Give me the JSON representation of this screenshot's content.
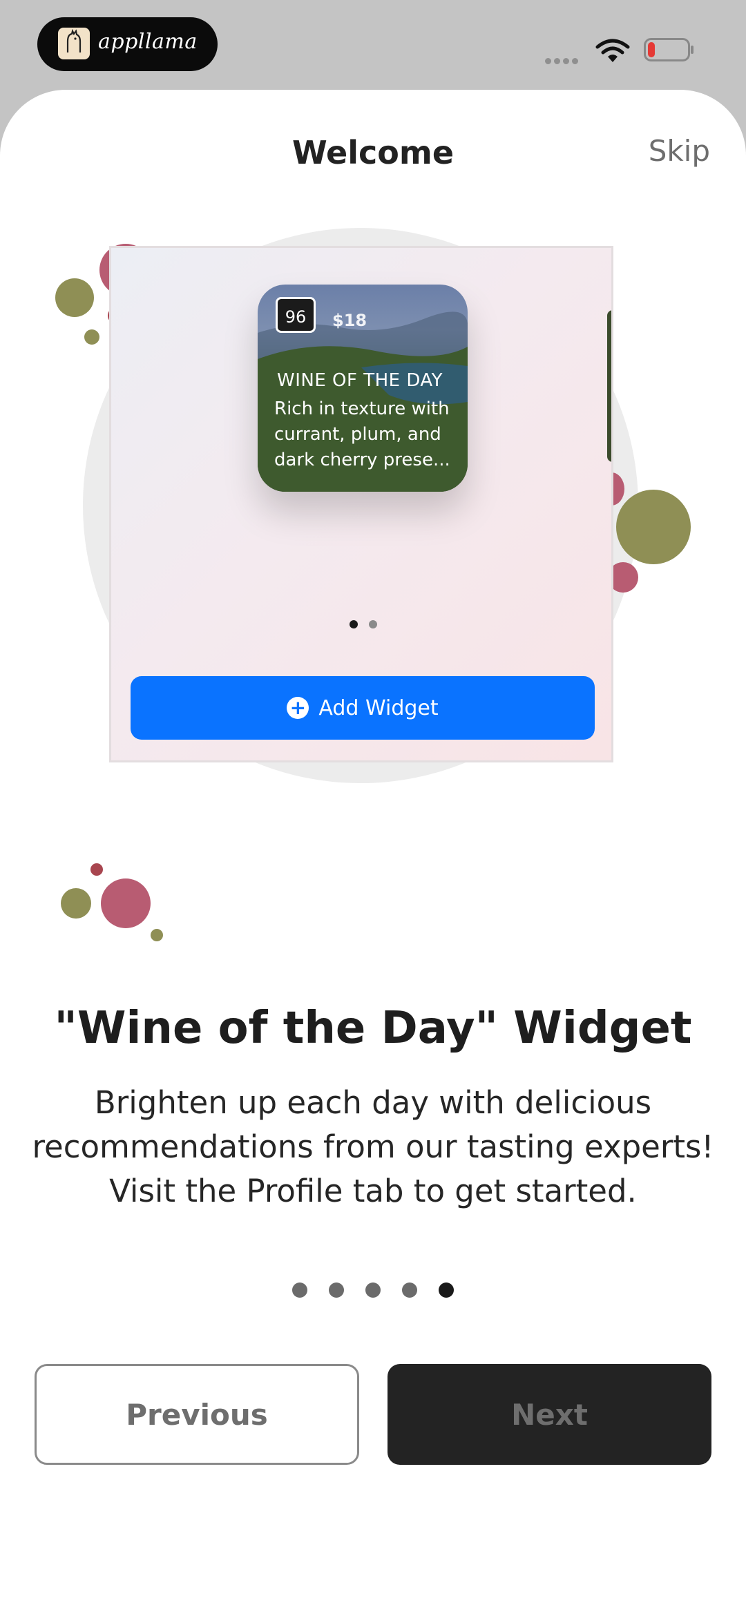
{
  "status_bar": {
    "app_name": "appllama",
    "icons": [
      "cellular-signal-icon",
      "wifi-icon",
      "battery-low-icon"
    ],
    "battery_color": "#e53935"
  },
  "header": {
    "title": "Welcome",
    "skip_label": "Skip"
  },
  "illustration": {
    "widget": {
      "score": "96",
      "price": "$18",
      "heading": "WINE OF THE DAY",
      "body": "Rich in texture with currant, plum, and dark cherry prese..."
    },
    "pager": {
      "count": 2,
      "active": 0
    },
    "add_widget_label": "Add Widget",
    "add_widget_color": "#0a73ff",
    "accent_colors": {
      "rose": "#b85c72",
      "olive": "#8f8f55",
      "wine": "#a8454f"
    }
  },
  "content": {
    "headline": "\"Wine of the Day\" Widget",
    "description": "Brighten up each day with delicious recommendations from our tasting experts! Visit the Profile tab to get started."
  },
  "pager": {
    "count": 5,
    "active": 4
  },
  "buttons": {
    "previous_label": "Previous",
    "next_label": "Next"
  }
}
